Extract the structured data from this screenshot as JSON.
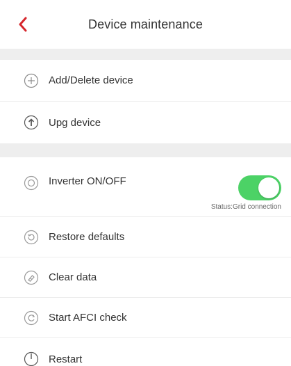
{
  "header": {
    "title": "Device maintenance"
  },
  "colors": {
    "accent": "#d6262c",
    "toggle_on": "#4cd266",
    "section_gap": "#eeeeee"
  },
  "items": {
    "add_delete": {
      "label": "Add/Delete device",
      "icon": "plus-circle-icon"
    },
    "upg": {
      "label": "Upg device",
      "icon": "up-arrow-circle-icon"
    },
    "inverter": {
      "label": "Inverter ON/OFF",
      "icon": "power-circle-icon",
      "toggle_on": true,
      "status": "Status:Grid connection"
    },
    "restore": {
      "label": "Restore defaults",
      "icon": "restore-icon"
    },
    "clear": {
      "label": "Clear data",
      "icon": "eraser-icon"
    },
    "afci": {
      "label": "Start AFCI check",
      "icon": "refresh-circle-icon"
    },
    "restart": {
      "label": "Restart",
      "icon": "power-icon"
    }
  }
}
